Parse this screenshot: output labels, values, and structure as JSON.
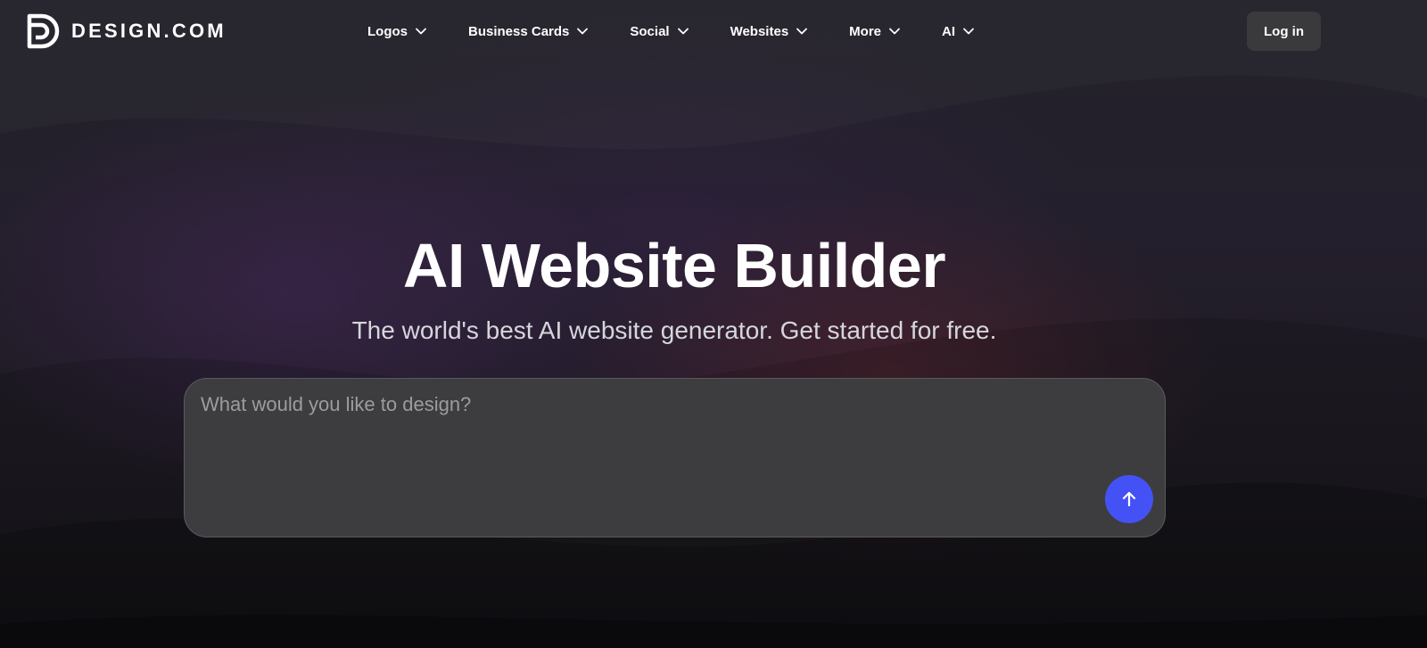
{
  "brand": {
    "name": "DESIGN.COM",
    "logo_icon": "design-com-logo-icon"
  },
  "nav": {
    "items": [
      {
        "label": "Logos",
        "icon": "chevron-down-icon"
      },
      {
        "label": "Business Cards",
        "icon": "chevron-down-icon"
      },
      {
        "label": "Social",
        "icon": "chevron-down-icon"
      },
      {
        "label": "Websites",
        "icon": "chevron-down-icon"
      },
      {
        "label": "More",
        "icon": "chevron-down-icon"
      },
      {
        "label": "AI",
        "icon": "chevron-down-icon"
      }
    ],
    "login_label": "Log in"
  },
  "hero": {
    "title": "AI Website Builder",
    "subtitle": "The world's best AI website generator. Get started for free."
  },
  "prompt": {
    "placeholder": "What would you like to design?",
    "value": "",
    "send_icon": "arrow-up-icon"
  },
  "colors": {
    "accent": "#4452f5",
    "login_bg": "#3a393c",
    "prompt_bg": "#3d3d3f"
  }
}
